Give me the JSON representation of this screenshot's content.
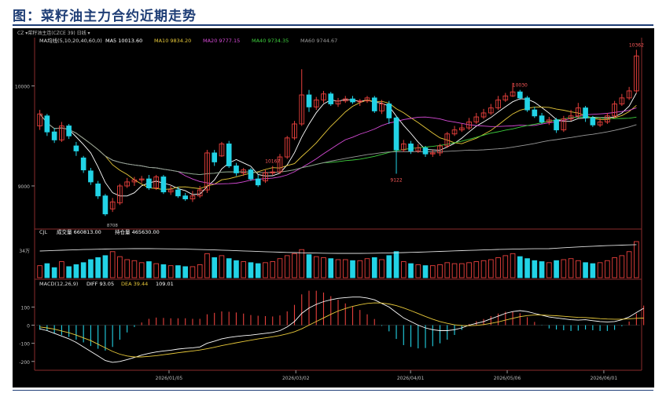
{
  "page": {
    "title": "图：菜籽油主力合约近期走势"
  },
  "chart_data": {
    "type": "candlestick",
    "top_bar": {
      "period": "日线",
      "symbol": "菜籽油主连(CZCE 39",
      "text": "CZ ▾菜籽油主连(CZCE 39)  日线 ▾"
    },
    "ma_legend": {
      "label": "MA均线(5,10,20,40,60,0)",
      "items": [
        {
          "name": "MA5",
          "value": "10013.60",
          "color": "#ffffff"
        },
        {
          "name": "MA10",
          "value": "9834.20",
          "color": "#e8c93a"
        },
        {
          "name": "MA20",
          "value": "9777.15",
          "color": "#d74bd7"
        },
        {
          "name": "MA40",
          "value": "9734.35",
          "color": "#3ecf3e"
        },
        {
          "name": "MA60",
          "value": "9744.67",
          "color": "#9a9a9a"
        }
      ]
    },
    "price_axis": {
      "ticks": [
        10000,
        9000
      ],
      "ylim": [
        8600,
        10420
      ]
    },
    "price_annotations": [
      {
        "label": "10167",
        "index": 32
      },
      {
        "label": "9122",
        "index": 49
      },
      {
        "label": "10030",
        "index": 66
      },
      {
        "label": "10362",
        "index": 82
      }
    ],
    "price_low_label": "8708",
    "candles": [
      {
        "o": 9600,
        "c": 9720,
        "h": 9760,
        "l": 9560
      },
      {
        "o": 9700,
        "c": 9540,
        "h": 9720,
        "l": 9500
      },
      {
        "o": 9540,
        "c": 9460,
        "h": 9580,
        "l": 9430
      },
      {
        "o": 9460,
        "c": 9600,
        "h": 9640,
        "l": 9440
      },
      {
        "o": 9600,
        "c": 9500,
        "h": 9620,
        "l": 9470
      },
      {
        "o": 9400,
        "c": 9350,
        "h": 9440,
        "l": 9300
      },
      {
        "o": 9280,
        "c": 9160,
        "h": 9300,
        "l": 9130
      },
      {
        "o": 9150,
        "c": 9040,
        "h": 9180,
        "l": 9010
      },
      {
        "o": 9020,
        "c": 8900,
        "h": 9050,
        "l": 8870
      },
      {
        "o": 8900,
        "c": 8720,
        "h": 8920,
        "l": 8700
      },
      {
        "o": 8770,
        "c": 8840,
        "h": 8880,
        "l": 8740
      },
      {
        "o": 8830,
        "c": 9000,
        "h": 9020,
        "l": 8810
      },
      {
        "o": 9000,
        "c": 9040,
        "h": 9080,
        "l": 8980
      },
      {
        "o": 9040,
        "c": 9060,
        "h": 9090,
        "l": 9000
      },
      {
        "o": 9060,
        "c": 9070,
        "h": 9100,
        "l": 9030
      },
      {
        "o": 9070,
        "c": 8980,
        "h": 9110,
        "l": 8960
      },
      {
        "o": 8980,
        "c": 9090,
        "h": 9110,
        "l": 8960
      },
      {
        "o": 9090,
        "c": 8940,
        "h": 9110,
        "l": 8920
      },
      {
        "o": 8940,
        "c": 8960,
        "h": 9000,
        "l": 8910
      },
      {
        "o": 8960,
        "c": 8900,
        "h": 8990,
        "l": 8880
      },
      {
        "o": 8900,
        "c": 8870,
        "h": 8930,
        "l": 8850
      },
      {
        "o": 8870,
        "c": 8900,
        "h": 8950,
        "l": 8840
      },
      {
        "o": 8900,
        "c": 8960,
        "h": 9000,
        "l": 8880
      },
      {
        "o": 8960,
        "c": 9330,
        "h": 9360,
        "l": 8930
      },
      {
        "o": 9330,
        "c": 9240,
        "h": 9360,
        "l": 9200
      },
      {
        "o": 9300,
        "c": 9420,
        "h": 9440,
        "l": 9290
      },
      {
        "o": 9420,
        "c": 9200,
        "h": 9450,
        "l": 9180
      },
      {
        "o": 9200,
        "c": 9130,
        "h": 9230,
        "l": 9100
      },
      {
        "o": 9130,
        "c": 9160,
        "h": 9180,
        "l": 9100
      },
      {
        "o": 9160,
        "c": 9070,
        "h": 9180,
        "l": 9050
      },
      {
        "o": 9070,
        "c": 9010,
        "h": 9110,
        "l": 8990
      },
      {
        "o": 9050,
        "c": 9130,
        "h": 9160,
        "l": 9030
      },
      {
        "o": 9130,
        "c": 9140,
        "h": 9200,
        "l": 9110
      },
      {
        "o": 9140,
        "c": 9290,
        "h": 9320,
        "l": 9120
      },
      {
        "o": 9290,
        "c": 9480,
        "h": 9500,
        "l": 9270
      },
      {
        "o": 9480,
        "c": 9620,
        "h": 9650,
        "l": 9460
      },
      {
        "o": 9620,
        "c": 9910,
        "h": 10167,
        "l": 9600
      },
      {
        "o": 9910,
        "c": 9790,
        "h": 9960,
        "l": 9740
      },
      {
        "o": 9790,
        "c": 9860,
        "h": 9890,
        "l": 9760
      },
      {
        "o": 9860,
        "c": 9920,
        "h": 9950,
        "l": 9830
      },
      {
        "o": 9920,
        "c": 9820,
        "h": 9940,
        "l": 9800
      },
      {
        "o": 9820,
        "c": 9850,
        "h": 9880,
        "l": 9790
      },
      {
        "o": 9850,
        "c": 9870,
        "h": 9900,
        "l": 9830
      },
      {
        "o": 9870,
        "c": 9840,
        "h": 9900,
        "l": 9820
      },
      {
        "o": 9840,
        "c": 9850,
        "h": 9870,
        "l": 9800
      },
      {
        "o": 9850,
        "c": 9880,
        "h": 9900,
        "l": 9830
      },
      {
        "o": 9880,
        "c": 9750,
        "h": 9900,
        "l": 9730
      },
      {
        "o": 9750,
        "c": 9820,
        "h": 9860,
        "l": 9720
      },
      {
        "o": 9820,
        "c": 9680,
        "h": 9850,
        "l": 9620
      },
      {
        "o": 9680,
        "c": 9360,
        "h": 9700,
        "l": 9122
      },
      {
        "o": 9360,
        "c": 9420,
        "h": 9460,
        "l": 9340
      },
      {
        "o": 9420,
        "c": 9350,
        "h": 9450,
        "l": 9320
      },
      {
        "o": 9350,
        "c": 9380,
        "h": 9420,
        "l": 9330
      },
      {
        "o": 9380,
        "c": 9320,
        "h": 9400,
        "l": 9290
      },
      {
        "o": 9320,
        "c": 9330,
        "h": 9360,
        "l": 9290
      },
      {
        "o": 9330,
        "c": 9400,
        "h": 9420,
        "l": 9300
      },
      {
        "o": 9400,
        "c": 9520,
        "h": 9540,
        "l": 9380
      },
      {
        "o": 9520,
        "c": 9560,
        "h": 9600,
        "l": 9500
      },
      {
        "o": 9560,
        "c": 9580,
        "h": 9620,
        "l": 9540
      },
      {
        "o": 9580,
        "c": 9640,
        "h": 9680,
        "l": 9560
      },
      {
        "o": 9640,
        "c": 9690,
        "h": 9730,
        "l": 9620
      },
      {
        "o": 9690,
        "c": 9730,
        "h": 9770,
        "l": 9670
      },
      {
        "o": 9730,
        "c": 9780,
        "h": 9820,
        "l": 9710
      },
      {
        "o": 9780,
        "c": 9860,
        "h": 9900,
        "l": 9760
      },
      {
        "o": 9860,
        "c": 9900,
        "h": 9930,
        "l": 9840
      },
      {
        "o": 9900,
        "c": 9940,
        "h": 10030,
        "l": 9890
      },
      {
        "o": 9940,
        "c": 9880,
        "h": 9960,
        "l": 9860
      },
      {
        "o": 9880,
        "c": 9760,
        "h": 9900,
        "l": 9740
      },
      {
        "o": 9760,
        "c": 9700,
        "h": 9790,
        "l": 9680
      },
      {
        "o": 9700,
        "c": 9640,
        "h": 9730,
        "l": 9620
      },
      {
        "o": 9640,
        "c": 9660,
        "h": 9690,
        "l": 9610
      },
      {
        "o": 9660,
        "c": 9560,
        "h": 9680,
        "l": 9530
      },
      {
        "o": 9560,
        "c": 9670,
        "h": 9700,
        "l": 9540
      },
      {
        "o": 9670,
        "c": 9700,
        "h": 9760,
        "l": 9650
      },
      {
        "o": 9700,
        "c": 9780,
        "h": 9830,
        "l": 9680
      },
      {
        "o": 9780,
        "c": 9680,
        "h": 9800,
        "l": 9640
      },
      {
        "o": 9680,
        "c": 9610,
        "h": 9700,
        "l": 9590
      },
      {
        "o": 9610,
        "c": 9640,
        "h": 9680,
        "l": 9590
      },
      {
        "o": 9640,
        "c": 9700,
        "h": 9730,
        "l": 9620
      },
      {
        "o": 9700,
        "c": 9820,
        "h": 9850,
        "l": 9680
      },
      {
        "o": 9820,
        "c": 9880,
        "h": 9920,
        "l": 9800
      },
      {
        "o": 9880,
        "c": 9950,
        "h": 9990,
        "l": 9860
      },
      {
        "o": 9950,
        "c": 10300,
        "h": 10362,
        "l": 9930
      }
    ],
    "volume_panel": {
      "label": "CJL",
      "items": [
        {
          "name": "成交量",
          "value": "660813.00"
        },
        {
          "name": "持仓量",
          "value": "465630.00"
        }
      ],
      "axis_label": "34万",
      "values": [
        12,
        14,
        10,
        16,
        11,
        13,
        15,
        18,
        20,
        22,
        26,
        21,
        18,
        17,
        15,
        16,
        14,
        13,
        12,
        12,
        11,
        11,
        13,
        24,
        20,
        22,
        19,
        17,
        16,
        15,
        14,
        15,
        16,
        19,
        22,
        24,
        28,
        23,
        21,
        20,
        19,
        18,
        18,
        17,
        17,
        19,
        20,
        18,
        22,
        26,
        16,
        14,
        13,
        12,
        12,
        13,
        15,
        14,
        14,
        15,
        16,
        17,
        18,
        20,
        22,
        24,
        21,
        19,
        17,
        16,
        15,
        17,
        18,
        19,
        17,
        15,
        14,
        15,
        17,
        20,
        22,
        26,
        36
      ]
    },
    "macd_panel": {
      "label": "MACD(12,26,9)",
      "items": [
        {
          "name": "DIFF",
          "value": "93.05",
          "color": "#ffffff"
        },
        {
          "name": "DEA",
          "value": "39.44",
          "color": "#e8c93a"
        },
        {
          "name": "",
          "value": "109.01",
          "color": "#ffffff"
        }
      ],
      "ticks": [
        100,
        0,
        -100,
        -200
      ],
      "ylim": [
        -240,
        210
      ],
      "diff": [
        -20,
        -30,
        -45,
        -60,
        -75,
        -95,
        -120,
        -145,
        -170,
        -195,
        -205,
        -200,
        -190,
        -178,
        -165,
        -155,
        -148,
        -142,
        -138,
        -132,
        -128,
        -125,
        -120,
        -100,
        -88,
        -75,
        -68,
        -62,
        -58,
        -55,
        -50,
        -45,
        -40,
        -30,
        -10,
        20,
        65,
        95,
        115,
        130,
        140,
        148,
        152,
        155,
        155,
        150,
        140,
        120,
        100,
        70,
        40,
        20,
        0,
        -15,
        -25,
        -30,
        -30,
        -25,
        -15,
        0,
        10,
        20,
        35,
        50,
        65,
        75,
        80,
        75,
        65,
        55,
        45,
        40,
        35,
        30,
        28,
        30,
        25,
        20,
        18,
        20,
        30,
        45,
        70,
        93
      ],
      "dea": [
        -10,
        -15,
        -22,
        -32,
        -42,
        -55,
        -70,
        -85,
        -105,
        -125,
        -145,
        -160,
        -170,
        -175,
        -175,
        -172,
        -168,
        -163,
        -158,
        -152,
        -147,
        -142,
        -137,
        -130,
        -122,
        -113,
        -105,
        -97,
        -90,
        -83,
        -76,
        -70,
        -64,
        -57,
        -48,
        -36,
        -20,
        0,
        20,
        40,
        60,
        78,
        92,
        104,
        113,
        120,
        123,
        122,
        117,
        108,
        95,
        80,
        64,
        48,
        33,
        20,
        10,
        2,
        -2,
        -3,
        -1,
        3,
        10,
        18,
        28,
        38,
        47,
        53,
        56,
        56,
        54,
        52,
        49,
        46,
        43,
        42,
        39,
        36,
        34,
        33,
        33,
        35,
        38,
        39
      ],
      "hist": [
        -25,
        -30,
        -45,
        -55,
        -65,
        -80,
        -95,
        -115,
        -130,
        -140,
        -120,
        -80,
        -40,
        -10,
        15,
        35,
        42,
        40,
        38,
        38,
        38,
        35,
        35,
        60,
        68,
        76,
        74,
        70,
        64,
        56,
        52,
        50,
        48,
        54,
        76,
        112,
        170,
        190,
        190,
        180,
        160,
        140,
        120,
        102,
        84,
        60,
        34,
        -4,
        -34,
        -76,
        -110,
        -120,
        -128,
        -126,
        -116,
        -100,
        -80,
        -54,
        -26,
        6,
        22,
        34,
        50,
        64,
        74,
        74,
        66,
        44,
        18,
        -2,
        -18,
        -24,
        -28,
        -32,
        -30,
        -24,
        -28,
        -32,
        -32,
        -26,
        -6,
        20,
        64,
        108
      ]
    },
    "x_dates": [
      {
        "label": "2026/01/05",
        "index": 22
      },
      {
        "label": "2026/03/02",
        "index": 43
      },
      {
        "label": "2026/04/01",
        "index": 62
      },
      {
        "label": "2026/05/06",
        "index": 78
      },
      {
        "label": "2026/06/01",
        "index": 94
      }
    ],
    "colors": {
      "up": "#e8403c",
      "down": "#22d3e6",
      "background": "#000000",
      "axis": "#8a2b2b"
    }
  }
}
